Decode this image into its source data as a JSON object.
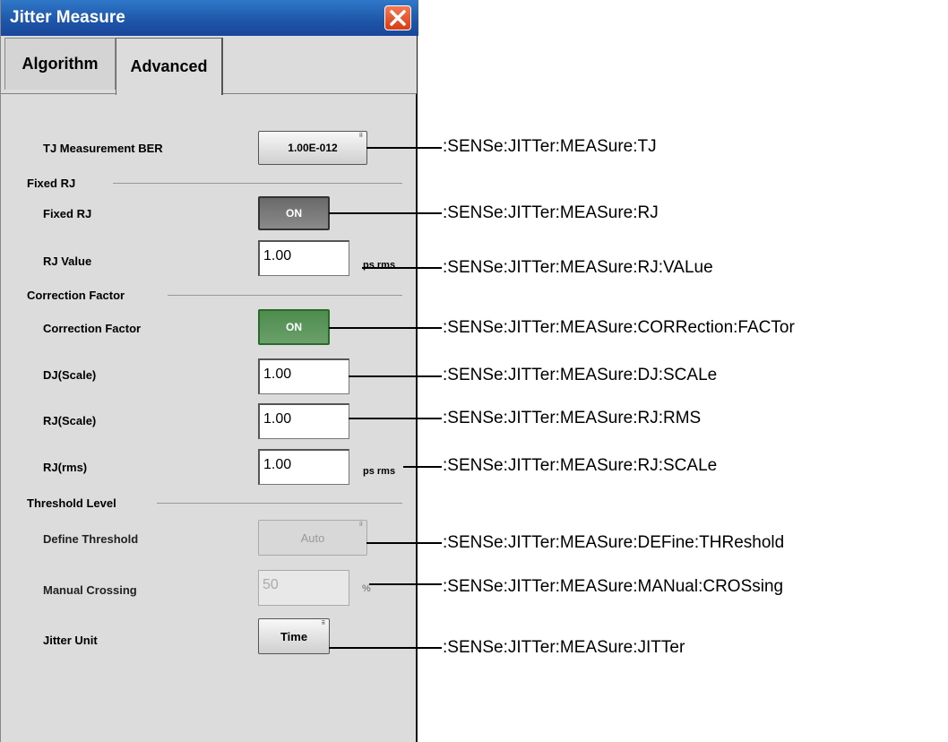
{
  "window": {
    "title": "Jitter Measure"
  },
  "tabs": [
    {
      "label": "Algorithm"
    },
    {
      "label": "Advanced"
    }
  ],
  "rows": {
    "tj_ber": {
      "label": "TJ Measurement BER",
      "value": "1.00E-012"
    },
    "fixed_rj_section": "Fixed RJ",
    "fixed_rj": {
      "label": "Fixed RJ",
      "value": "ON"
    },
    "rj_value": {
      "label": "RJ Value",
      "value": "1.00",
      "unit": "ps rms"
    },
    "correction_section": "Correction Factor",
    "correction_factor": {
      "label": "Correction Factor",
      "value": "ON"
    },
    "dj_scale": {
      "label": "DJ(Scale)",
      "value": "1.00"
    },
    "rj_scale": {
      "label": "RJ(Scale)",
      "value": "1.00"
    },
    "rj_rms": {
      "label": "RJ(rms)",
      "value": "1.00",
      "unit": "ps rms"
    },
    "threshold_section": "Threshold Level",
    "define_threshold": {
      "label": "Define Threshold",
      "value": "Auto"
    },
    "manual_crossing": {
      "label": "Manual Crossing",
      "value": "50",
      "unit": "%"
    },
    "jitter_unit": {
      "label": "Jitter Unit",
      "value": "Time"
    }
  },
  "commands": {
    "tj": ":SENSe:JITTer:MEASure:TJ",
    "rj": ":SENSe:JITTer:MEASure:RJ",
    "rj_value": ":SENSe:JITTer:MEASure:RJ:VALue",
    "correction": ":SENSe:JITTer:MEASure:CORRection:FACTor",
    "dj_scale": ":SENSe:JITTer:MEASure:DJ:SCALe",
    "rj_rms": ":SENSe:JITTer:MEASure:RJ:RMS",
    "rj_scale": ":SENSe:JITTer:MEASure:RJ:SCALe",
    "threshold": ":SENSe:JITTer:MEASure:DEFine:THReshold",
    "crossing": ":SENSe:JITTer:MEASure:MANual:CROSsing",
    "jitter": ":SENSe:JITTer:MEASure:JITTer"
  },
  "colors": {
    "titlebar": "#1e55a8",
    "close": "#d83b14",
    "on_green": "#4e8c4e"
  }
}
